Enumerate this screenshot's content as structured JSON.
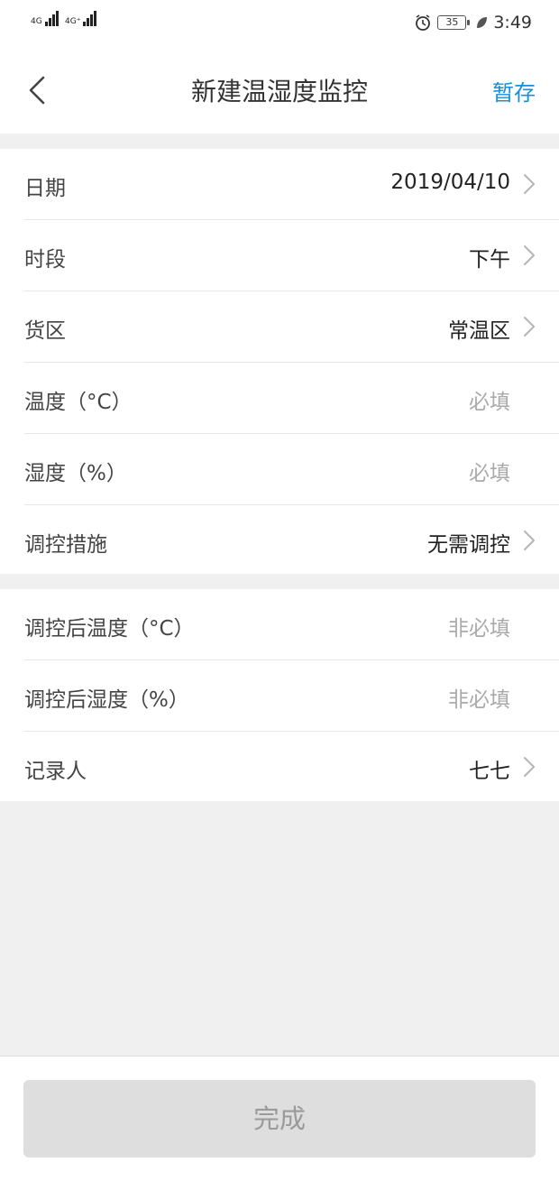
{
  "status_bar": {
    "signal1_label": "4G",
    "signal2_label": "4G⁺",
    "battery": "35",
    "time": "3:49"
  },
  "nav": {
    "title": "新建温湿度监控",
    "save_label": "暂存"
  },
  "section1": [
    {
      "label": "日期",
      "value": "2019/04/10",
      "placeholder": false,
      "chevron": true
    },
    {
      "label": "时段",
      "value": "下午",
      "placeholder": false,
      "chevron": true
    },
    {
      "label": "货区",
      "value": "常温区",
      "placeholder": false,
      "chevron": true
    },
    {
      "label": "温度（°C）",
      "value": "必填",
      "placeholder": true,
      "chevron": false
    },
    {
      "label": "湿度（%）",
      "value": "必填",
      "placeholder": true,
      "chevron": false
    },
    {
      "label": "调控措施",
      "value": "无需调控",
      "placeholder": false,
      "chevron": true
    }
  ],
  "section2": [
    {
      "label": "调控后温度（°C）",
      "value": "非必填",
      "placeholder": true,
      "chevron": false
    },
    {
      "label": "调控后湿度（%）",
      "value": "非必填",
      "placeholder": true,
      "chevron": false
    },
    {
      "label": "记录人",
      "value": "七七",
      "placeholder": false,
      "chevron": true
    }
  ],
  "footer": {
    "done_label": "完成"
  },
  "colors": {
    "accent": "#1890d8",
    "background": "#f0f0f0",
    "placeholder": "#aaaaaa",
    "button_disabled": "#dedede"
  }
}
